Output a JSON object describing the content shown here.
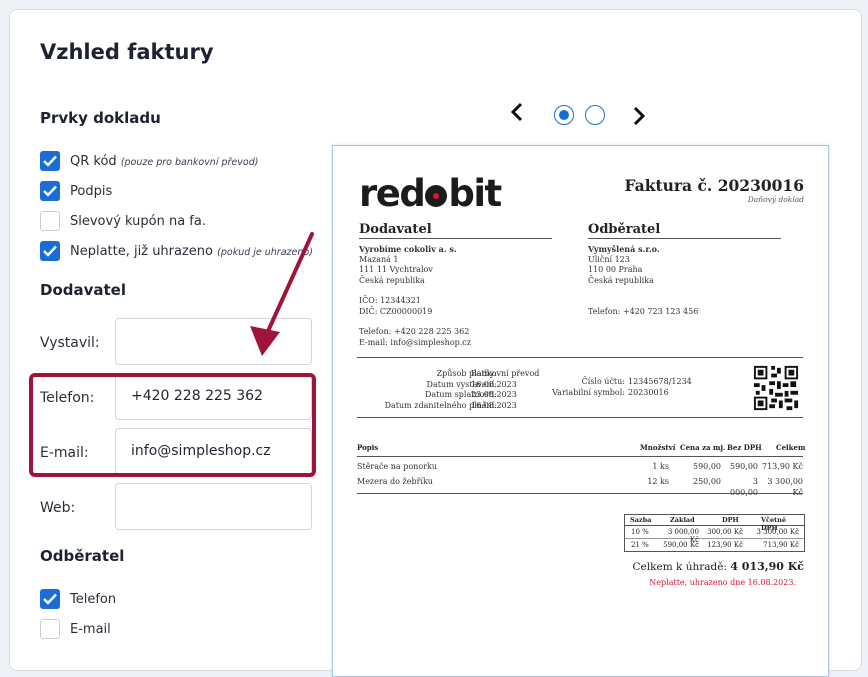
{
  "page": {
    "title": "Vzhled faktury"
  },
  "sections": {
    "doc_elements": "Prvky dokladu",
    "supplier": "Dodavatel",
    "customer": "Odběratel"
  },
  "doc_items": [
    {
      "label": "QR kód",
      "note": "(pouze pro bankovní převod)",
      "checked": true
    },
    {
      "label": "Podpis",
      "note": "",
      "checked": true
    },
    {
      "label": "Slevový kupón na fa.",
      "note": "",
      "checked": false
    },
    {
      "label": "Neplatte, již uhrazeno",
      "note": "(pokud je uhrazeno)",
      "checked": true
    }
  ],
  "supplier_fields": {
    "issued_by": {
      "label": "Vystavil:",
      "value": ""
    },
    "phone": {
      "label": "Telefon:",
      "value": "+420 228 225 362"
    },
    "email": {
      "label": "E-mail:",
      "value": "info@simpleshop.cz"
    },
    "web": {
      "label": "Web:",
      "value": ""
    }
  },
  "customer_items": [
    {
      "label": "Telefon",
      "checked": true
    },
    {
      "label": "E-mail",
      "checked": false
    }
  ],
  "carousel": {
    "prev": "‹",
    "next": "›",
    "active_index": 0,
    "count": 2
  },
  "invoice": {
    "logo": {
      "left": "red",
      "right": "bit"
    },
    "number_title": "Faktura č. 20230016",
    "subtitle": "Daňový doklad",
    "supplier": {
      "heading": "Dodavatel",
      "name": "Vyrobíme cokoliv a. s.",
      "street": "Mazaná 1",
      "city": "111 11 Vychtralov",
      "country": "Česká republika",
      "ico": "IČO: 12344321",
      "dic": "DIČ: CZ00000019",
      "phone": "Telefon: +420 228 225 362",
      "email": "E-mail: info@simpleshop.cz"
    },
    "customer": {
      "heading": "Odběratel",
      "name": "Vymyšlená s.r.o.",
      "street": "Uliční 123",
      "city": "110 00 Praha",
      "country": "Česká republika",
      "phone": "Telefon: +420 723 123 456"
    },
    "payment": {
      "method_label": "Způsob platby:",
      "method": "Bankovní převod",
      "issued_label": "Datum vystavení:",
      "issued": "16.08.2023",
      "due_label": "Datum splatnosti:",
      "due": "23.08.2023",
      "taxable_label": "Datum zdanitelného plnění:",
      "taxable": "16.08.2023",
      "account_label": "Číslo účtu:",
      "account": "12345678/1234",
      "vs_label": "Variabilní symbol:",
      "vs": "20230016"
    },
    "items_header": {
      "desc": "Popis",
      "qty": "Množství",
      "unit_price": "Cena za mj.",
      "no_vat": "Bez DPH",
      "total": "Celkem"
    },
    "items": [
      {
        "desc": "Stěrače na ponorku",
        "qty": "1 ks",
        "unit_price": "590,00",
        "no_vat": "590,00",
        "total": "713,90 Kč"
      },
      {
        "desc": "Mezera do žebříku",
        "qty": "12 ks",
        "unit_price": "250,00",
        "no_vat": "3 000,00",
        "total": "3 300,00 Kč"
      }
    ],
    "tax_header": {
      "rate": "Sazba",
      "base": "Základ",
      "vat": "DPH",
      "incl": "Včetně DPH"
    },
    "tax_rows": [
      {
        "rate": "10 %",
        "base": "3 000,00 Kč",
        "vat": "300,00 Kč",
        "incl": "3 300,00 Kč"
      },
      {
        "rate": "21 %",
        "base": "590,00 Kč",
        "vat": "123,90 Kč",
        "incl": "713,90 Kč"
      }
    ],
    "total_label": "Celkem k úhradě:",
    "total_value": "4 013,90 Kč",
    "paid_note": "Neplatte, uhrazeno dne 16.08.2023."
  },
  "colors": {
    "accent": "#1a6dd4",
    "highlight": "#a0143a",
    "paid_note": "#d8153a"
  }
}
